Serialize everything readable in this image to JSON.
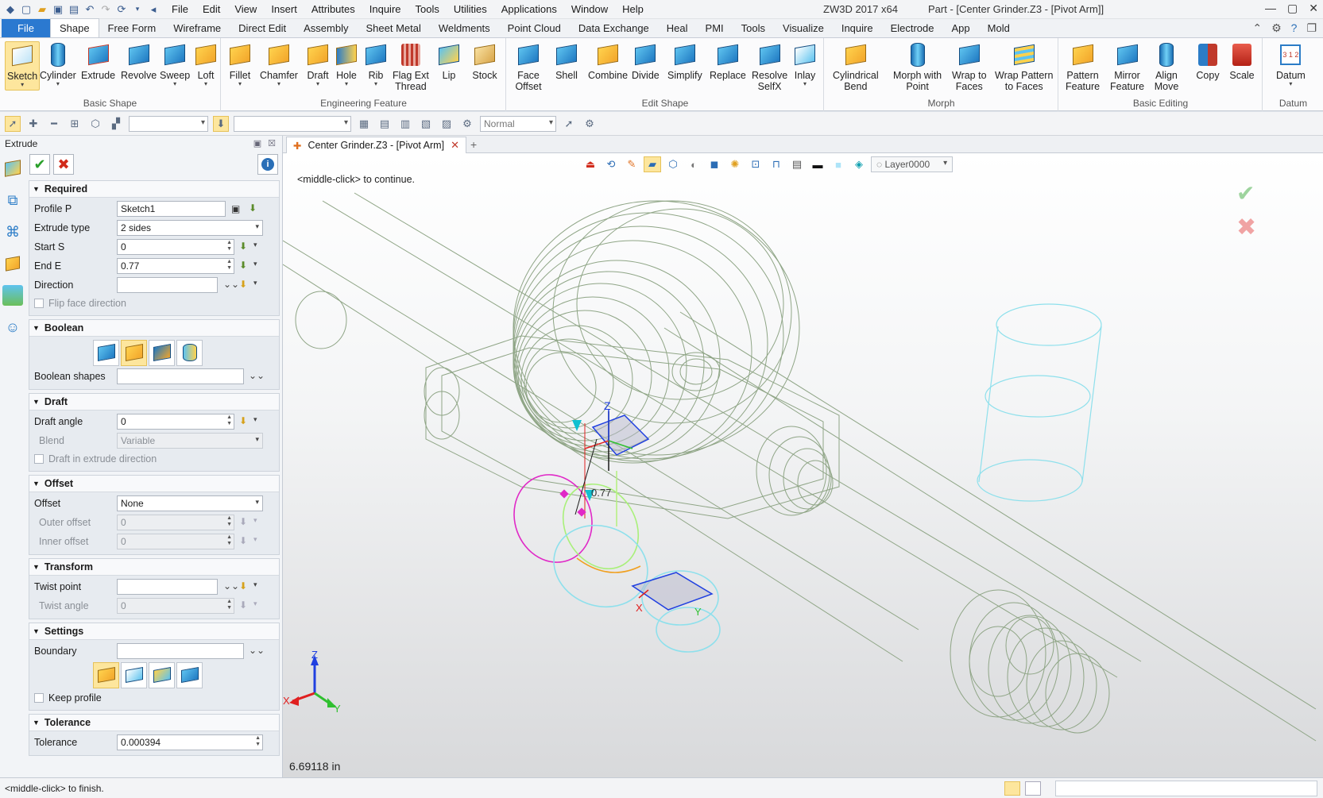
{
  "titlebar": {
    "menus": [
      "File",
      "Edit",
      "View",
      "Insert",
      "Attributes",
      "Inquire",
      "Tools",
      "Utilities",
      "Applications",
      "Window",
      "Help"
    ],
    "app_title": "ZW3D 2017  x64",
    "doc_title": "Part - [Center Grinder.Z3 - [Pivot Arm]]"
  },
  "ribbon_tabs": [
    "File",
    "Shape",
    "Free Form",
    "Wireframe",
    "Direct Edit",
    "Assembly",
    "Sheet Metal",
    "Weldments",
    "Point Cloud",
    "Data Exchange",
    "Heal",
    "PMI",
    "Tools",
    "Visualize",
    "Inquire",
    "Electrode",
    "App",
    "Mold"
  ],
  "ribbon_active_tab": "Shape",
  "ribbon": {
    "basic_shape": {
      "label": "Basic Shape",
      "buttons": [
        "Sketch",
        "Cylinder",
        "Extrude",
        "Revolve",
        "Sweep",
        "Loft"
      ]
    },
    "engineering": {
      "label": "Engineering Feature",
      "buttons": [
        "Fillet",
        "Chamfer",
        "Draft",
        "Hole",
        "Rib",
        "Flag Ext",
        "Thread",
        "Lip",
        "Stock"
      ]
    },
    "edit_shape": {
      "label": "Edit Shape",
      "buttons": [
        "Face",
        "Offset",
        "Shell",
        "Combine",
        "Divide",
        "Simplify",
        "Replace",
        "Resolve",
        "SelfX",
        "Inlay"
      ]
    },
    "morph": {
      "label": "Morph",
      "buttons": [
        "Cylindrical",
        "Bend",
        "Morph with",
        "Point",
        "Wrap to",
        "Faces",
        "Wrap Pattern",
        "to Faces"
      ]
    },
    "basic_editing": {
      "label": "Basic Editing",
      "buttons": [
        "Pattern",
        "Feature",
        "Mirror",
        "Feature",
        "Align",
        "Move",
        "Copy",
        "Scale"
      ]
    },
    "datum": {
      "label": "Datum",
      "buttons": [
        "Datum"
      ]
    }
  },
  "toolbar2": {
    "render_mode": "Normal"
  },
  "panel": {
    "title": "Extrude",
    "required": {
      "title": "Required",
      "profile_label": "Profile P",
      "profile_value": "Sketch1",
      "extrude_type_label": "Extrude type",
      "extrude_type_value": "2 sides",
      "start_label": "Start S",
      "start_value": "0",
      "end_label": "End E",
      "end_value": "0.77",
      "direction_label": "Direction",
      "direction_value": "",
      "flip_label": "Flip face direction"
    },
    "boolean": {
      "title": "Boolean",
      "shapes_label": "Boolean shapes",
      "shapes_value": ""
    },
    "draft": {
      "title": "Draft",
      "angle_label": "Draft angle",
      "angle_value": "0",
      "blend_label": "Blend",
      "blend_value": "Variable",
      "extrude_dir_label": "Draft in extrude direction"
    },
    "offset": {
      "title": "Offset",
      "offset_label": "Offset",
      "offset_value": "None",
      "outer_label": "Outer offset",
      "outer_value": "0",
      "inner_label": "Inner offset",
      "inner_value": "0"
    },
    "transform": {
      "title": "Transform",
      "twist_point_label": "Twist point",
      "twist_point_value": "",
      "twist_angle_label": "Twist angle",
      "twist_angle_value": "0"
    },
    "settings": {
      "title": "Settings",
      "boundary_label": "Boundary",
      "boundary_value": "",
      "keep_profile_label": "Keep profile"
    },
    "tolerance": {
      "title": "Tolerance",
      "label": "Tolerance",
      "value": "0.000394"
    }
  },
  "doc_tab": {
    "label": "Center Grinder.Z3 - [Pivot Arm]"
  },
  "viewport": {
    "layer": "Layer0000",
    "hint": "<middle-click> to continue.",
    "dimension_label": "0.77",
    "measurement": "6.69118 in",
    "axis_x": "X",
    "axis_y": "Y",
    "axis_z": "Z"
  },
  "status": {
    "text": "<middle-click> to finish."
  }
}
